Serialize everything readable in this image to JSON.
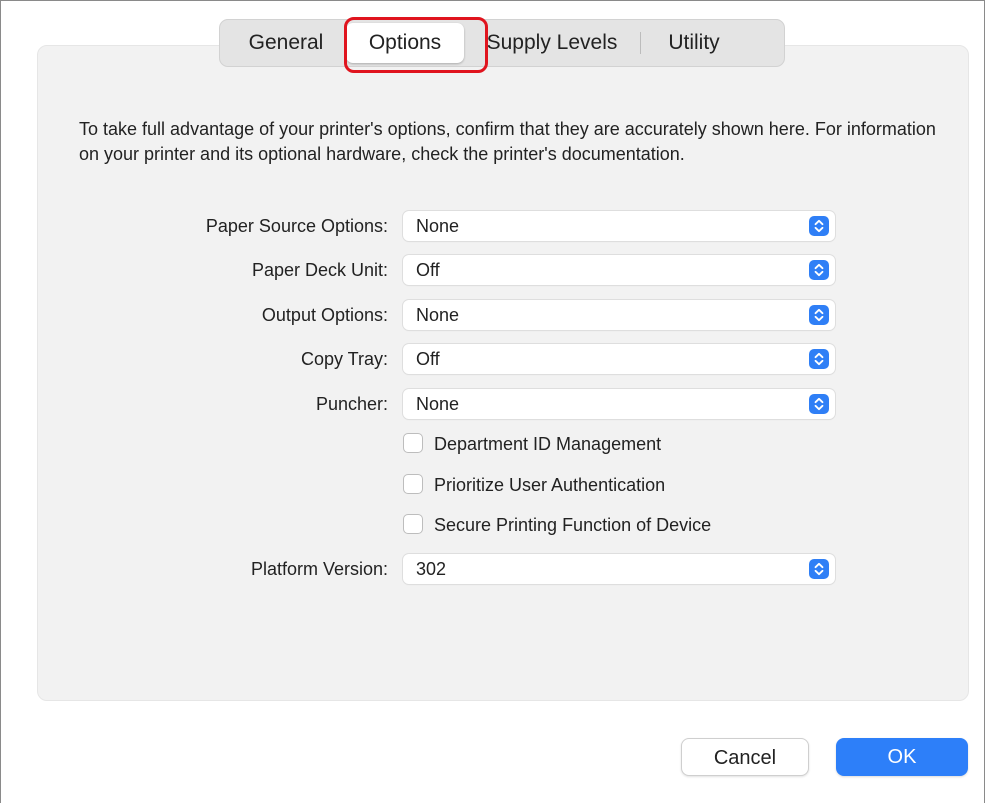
{
  "tabs": {
    "general": "General",
    "options": "Options",
    "supply_levels": "Supply Levels",
    "utility": "Utility",
    "selected": "Options"
  },
  "description": "To take full advantage of your printer's options, confirm that they are accurately shown here. For information on your printer and its optional hardware, check the printer's documentation.",
  "fields": {
    "paper_source": {
      "label": "Paper Source Options:",
      "value": "None"
    },
    "paper_deck": {
      "label": "Paper Deck Unit:",
      "value": "Off"
    },
    "output_options": {
      "label": "Output Options:",
      "value": "None"
    },
    "copy_tray": {
      "label": "Copy Tray:",
      "value": "Off"
    },
    "puncher": {
      "label": "Puncher:",
      "value": "None"
    },
    "platform_version": {
      "label": "Platform Version:",
      "value": "302"
    }
  },
  "checkboxes": {
    "department_id": {
      "label": "Department ID Management",
      "checked": false
    },
    "prioritize_auth": {
      "label": "Prioritize User Authentication",
      "checked": false
    },
    "secure_printing": {
      "label": "Secure Printing Function of Device",
      "checked": false
    }
  },
  "buttons": {
    "cancel": "Cancel",
    "ok": "OK"
  },
  "colors": {
    "accent": "#2d7ff9",
    "highlight": "#e0141e"
  },
  "icons": {
    "stepper": "chevron-up-down-icon"
  }
}
